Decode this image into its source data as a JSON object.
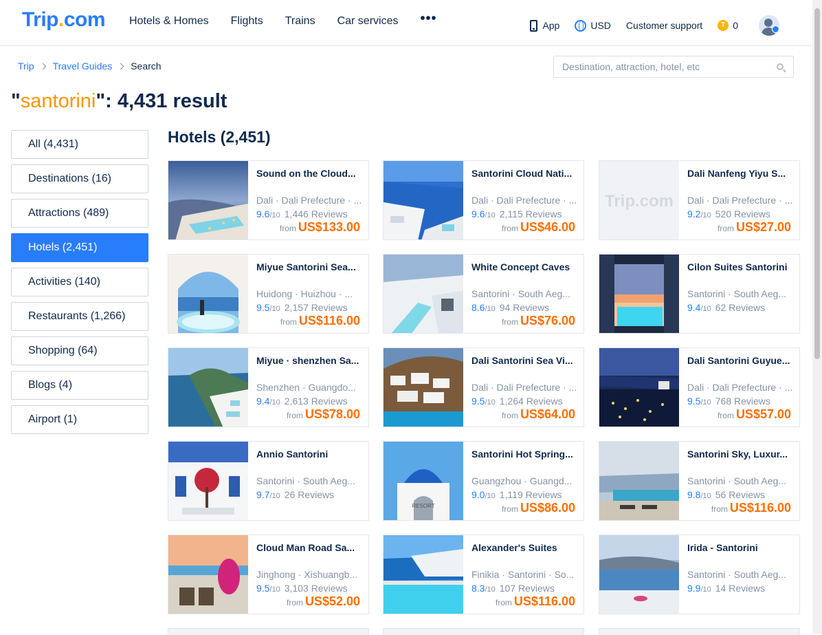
{
  "header": {
    "logo_main": "Trip",
    "logo_dot": ".",
    "logo_suffix": "com",
    "nav": [
      "Hotels & Homes",
      "Flights",
      "Trains",
      "Car services"
    ],
    "nav_more": "•••",
    "app_label": "App",
    "currency_label": "USD",
    "support_label": "Customer support",
    "coin_symbol": "T",
    "coins": "0"
  },
  "breadcrumb": [
    "Trip",
    "Travel Guides",
    "Search"
  ],
  "search": {
    "placeholder": "Destination, attraction, hotel, etc",
    "value": ""
  },
  "result": {
    "open_quote": "\"",
    "keyword": "santorini",
    "suffix": "\": 4,431 result"
  },
  "sidebar": [
    {
      "label": "All (4,431)",
      "active": false
    },
    {
      "label": "Destinations (16)",
      "active": false
    },
    {
      "label": "Attractions (489)",
      "active": false
    },
    {
      "label": "Hotels (2,451)",
      "active": true
    },
    {
      "label": "Activities (140)",
      "active": false
    },
    {
      "label": "Restaurants (1,266)",
      "active": false
    },
    {
      "label": "Shopping (64)",
      "active": false
    },
    {
      "label": "Blogs (4)",
      "active": false
    },
    {
      "label": "Airport (1)",
      "active": false
    }
  ],
  "section_title": "Hotels (2,451)",
  "hotels": [
    {
      "name": "Sound on the Cloud...",
      "location": "Dali · Dali Prefecture · ...",
      "score": "9.6",
      "score_max": "/10",
      "reviews": "1,446 Reviews",
      "from": "from",
      "price": "US$133.00",
      "image": "sunset-terrace-pool"
    },
    {
      "name": "Santorini Cloud Nati...",
      "location": "Dali · Dali Prefecture · ...",
      "score": "9.6",
      "score_max": "/10",
      "reviews": "2,115 Reviews",
      "from": "from",
      "price": "US$46.00",
      "image": "white-village-sea"
    },
    {
      "name": "Dali Nanfeng Yiyu S...",
      "location": "Dali · Dali Prefecture · ...",
      "score": "9.2",
      "score_max": "/10",
      "reviews": "520 Reviews",
      "from": "from",
      "price": "US$27.00",
      "image": "trip-placeholder"
    },
    {
      "name": "Miyue Santorini Sea...",
      "location": "Huidong · Huizhou · ...",
      "score": "9.5",
      "score_max": "/10",
      "reviews": "2,157 Reviews",
      "from": "from",
      "price": "US$116.00",
      "image": "arch-jacuzzi"
    },
    {
      "name": "White Concept Caves",
      "location": "Santorini · South Aeg...",
      "score": "8.6",
      "score_max": "/10",
      "reviews": "94 Reviews",
      "from": "from",
      "price": "US$76.00",
      "image": "cave-steps-pool"
    },
    {
      "name": "Cilon Suites Santorini",
      "location": "Santorini · South Aeg...",
      "score": "9.4",
      "score_max": "/10",
      "reviews": "62 Reviews",
      "from": "",
      "price": "",
      "image": "window-pool-sunset"
    },
    {
      "name": "Miyue · shenzhen Sa...",
      "location": "Shenzhen · Guangdo...",
      "score": "9.4",
      "score_max": "/10",
      "reviews": "2,613 Reviews",
      "from": "from",
      "price": "US$78.00",
      "image": "coast-cliff-hotel"
    },
    {
      "name": "Dali Santorini Sea Vi...",
      "location": "Dali · Dali Prefecture · ...",
      "score": "9.5",
      "score_max": "/10",
      "reviews": "1,264 Reviews",
      "from": "from",
      "price": "US$64.00",
      "image": "hillside-village"
    },
    {
      "name": "Dali Santorini Guyue...",
      "location": "Dali · Dali Prefecture · ...",
      "score": "9.5",
      "score_max": "/10",
      "reviews": "768 Reviews",
      "from": "from",
      "price": "US$57.00",
      "image": "night-pool-lights"
    },
    {
      "name": "Annio Santorini",
      "location": "Santorini · South Aeg...",
      "score": "9.7",
      "score_max": "/10",
      "reviews": "26 Reviews",
      "from": "",
      "price": "",
      "image": "white-house-flowers"
    },
    {
      "name": "Santorini Hot Spring...",
      "location": "Guangzhou · Guangd...",
      "score": "9.0",
      "score_max": "/10",
      "reviews": "1,119 Reviews",
      "from": "from",
      "price": "US$86.00",
      "image": "blue-dome-resort"
    },
    {
      "name": "Santorini Sky, Luxur...",
      "location": "Santorini · South Aeg...",
      "score": "9.8",
      "score_max": "/10",
      "reviews": "56 Reviews",
      "from": "from",
      "price": "US$116.00",
      "image": "terrace-loungers"
    },
    {
      "name": "Cloud Man Road Sa...",
      "location": "Jinghong · Xishuangb...",
      "score": "9.5",
      "score_max": "/10",
      "reviews": "3,103 Reviews",
      "from": "from",
      "price": "US$52.00",
      "image": "pink-swing-chairs"
    },
    {
      "name": "Alexander's Suites",
      "location": "Finikia · Santorini · So...",
      "score": "8.3",
      "score_max": "/10",
      "reviews": "107 Reviews",
      "from": "from",
      "price": "US$116.00",
      "image": "turquoise-pool"
    },
    {
      "name": "Irida - Santorini",
      "location": "Santorini · South Aeg...",
      "score": "9.9",
      "score_max": "/10",
      "reviews": "14 Reviews",
      "from": "",
      "price": "",
      "image": "caldera-view"
    }
  ],
  "colors": {
    "brand": "#287dfa",
    "keyword": "#ff9500",
    "price": "#ff6f00",
    "text": "#0f294d",
    "muted": "#8592a6"
  }
}
